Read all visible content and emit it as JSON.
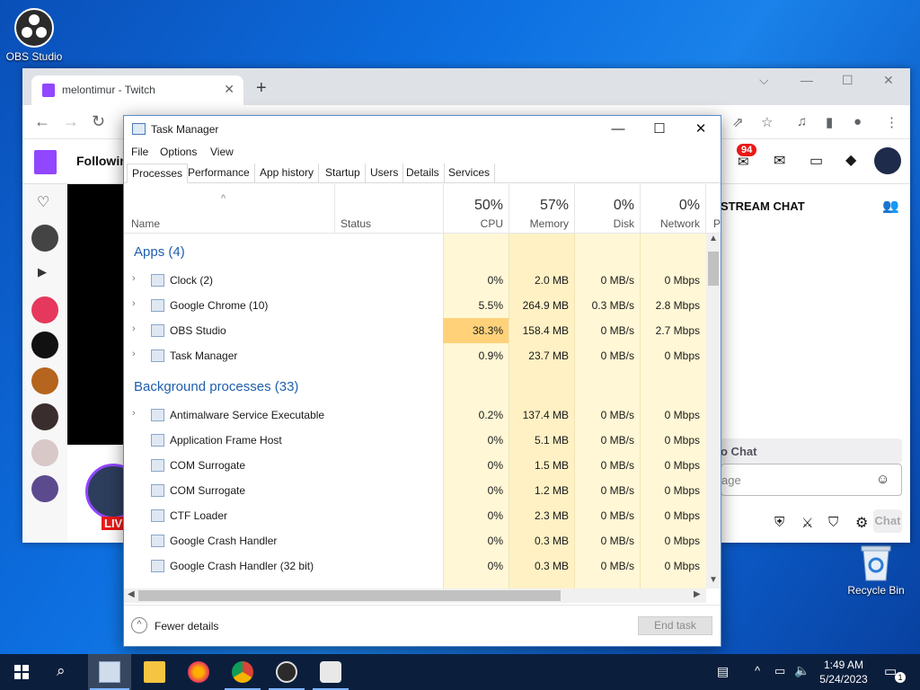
{
  "desktop": {
    "obs_label": "OBS Studio",
    "recycle_label": "Recycle Bin"
  },
  "browser": {
    "tab_title": "melontimur - Twitch",
    "tab_close": "✕",
    "new_tab": "+",
    "following": "Followin",
    "notif_count": "94",
    "stream_chat": "STREAM CHAT",
    "chat_title_partial": "o Chat",
    "chat_placeholder_partial": "age",
    "chat_button": "Chat",
    "live_badge": "LIV"
  },
  "taskmanager": {
    "title": "Task Manager",
    "menu": [
      "File",
      "Options",
      "View"
    ],
    "tabs": [
      "Processes",
      "Performance",
      "App history",
      "Startup",
      "Users",
      "Details",
      "Services"
    ],
    "active_tab": "Processes",
    "columns": {
      "name": "Name",
      "status": "Status",
      "cpu_pct": "50%",
      "cpu": "CPU",
      "mem_pct": "57%",
      "mem": "Memory",
      "disk_pct": "0%",
      "disk": "Disk",
      "net_pct": "0%",
      "net": "Network",
      "extra": "P"
    },
    "apps_group": "Apps (4)",
    "bg_group": "Background processes (33)",
    "apps": [
      {
        "name": "Clock (2)",
        "cpu": "0%",
        "mem": "2.0 MB",
        "disk": "0 MB/s",
        "net": "0 Mbps"
      },
      {
        "name": "Google Chrome (10)",
        "cpu": "5.5%",
        "mem": "264.9 MB",
        "disk": "0.3 MB/s",
        "net": "2.8 Mbps"
      },
      {
        "name": "OBS Studio",
        "cpu": "38.3%",
        "mem": "158.4 MB",
        "disk": "0 MB/s",
        "net": "2.7 Mbps"
      },
      {
        "name": "Task Manager",
        "cpu": "0.9%",
        "mem": "23.7 MB",
        "disk": "0 MB/s",
        "net": "0 Mbps"
      }
    ],
    "background": [
      {
        "name": "Antimalware Service Executable",
        "cpu": "0.2%",
        "mem": "137.4 MB",
        "disk": "0 MB/s",
        "net": "0 Mbps"
      },
      {
        "name": "Application Frame Host",
        "cpu": "0%",
        "mem": "5.1 MB",
        "disk": "0 MB/s",
        "net": "0 Mbps"
      },
      {
        "name": "COM Surrogate",
        "cpu": "0%",
        "mem": "1.5 MB",
        "disk": "0 MB/s",
        "net": "0 Mbps"
      },
      {
        "name": "COM Surrogate",
        "cpu": "0%",
        "mem": "1.2 MB",
        "disk": "0 MB/s",
        "net": "0 Mbps"
      },
      {
        "name": "CTF Loader",
        "cpu": "0%",
        "mem": "2.3 MB",
        "disk": "0 MB/s",
        "net": "0 Mbps"
      },
      {
        "name": "Google Crash Handler",
        "cpu": "0%",
        "mem": "0.3 MB",
        "disk": "0 MB/s",
        "net": "0 Mbps"
      },
      {
        "name": "Google Crash Handler (32 bit)",
        "cpu": "0%",
        "mem": "0.3 MB",
        "disk": "0 MB/s",
        "net": "0 Mbps"
      }
    ],
    "fewer_details": "Fewer details",
    "end_task": "End task"
  },
  "taskbar": {
    "time": "1:49 AM",
    "date": "5/24/2023",
    "notif_badge": "1"
  },
  "colors": {
    "accent": "#1f5fad",
    "heat_high": "#ffd27a",
    "heat_low": "#fff7d6",
    "twitch": "#9146ff"
  }
}
